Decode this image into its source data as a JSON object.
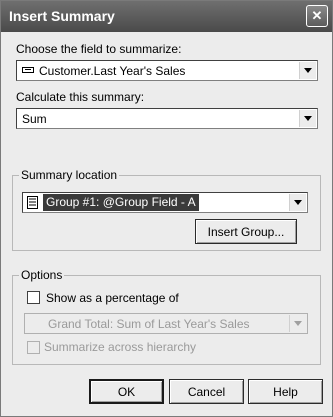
{
  "dialog": {
    "title": "Insert Summary",
    "close_icon": "close-icon"
  },
  "field": {
    "label": "Choose the field to summarize:",
    "value": "Customer.Last Year's Sales",
    "icon": "database-field-icon"
  },
  "summary": {
    "label": "Calculate this summary:",
    "value": "Sum"
  },
  "location": {
    "legend": "Summary location",
    "value": "Group #1: @Group Field - A",
    "icon": "group-icon",
    "insert_group_label": "Insert Group..."
  },
  "options": {
    "legend": "Options",
    "percentage_label": "Show as a percentage of",
    "percentage_checked": false,
    "percentage_value": "Grand Total: Sum of Last Year's Sales",
    "hierarchy_label": "Summarize across hierarchy",
    "hierarchy_checked": false
  },
  "footer": {
    "ok_label": "OK",
    "cancel_label": "Cancel",
    "help_label": "Help"
  }
}
